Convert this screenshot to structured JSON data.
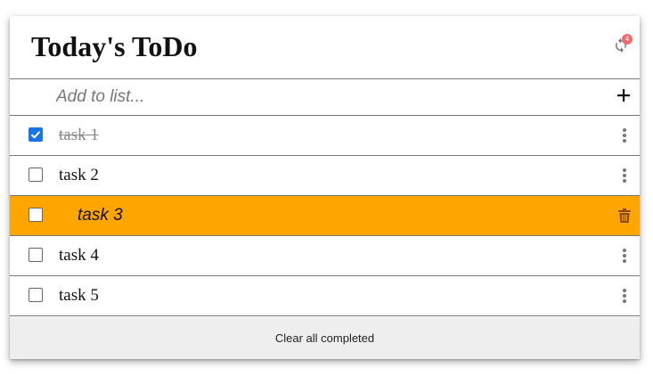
{
  "header": {
    "title": "Today's ToDo",
    "sync_icon": "sync-icon",
    "pending_count": "4"
  },
  "add": {
    "placeholder": "Add to list...",
    "add_icon": "plus-icon"
  },
  "tasks": [
    {
      "label": "task 1",
      "checked": true,
      "menu_icon": "more-vert-icon"
    },
    {
      "label": "task 2",
      "checked": false,
      "menu_icon": "more-vert-icon"
    },
    {
      "label": "task 3",
      "checked": false,
      "highlighted": true,
      "action_icon": "trash-icon"
    },
    {
      "label": "task 4",
      "checked": false,
      "menu_icon": "more-vert-icon"
    },
    {
      "label": "task 5",
      "checked": false,
      "menu_icon": "more-vert-icon"
    }
  ],
  "footer": {
    "clear_label": "Clear all completed"
  },
  "colors": {
    "highlight": "#ffa500",
    "checkbox_checked": "#1a73e8",
    "badge": "#f06a6a"
  }
}
